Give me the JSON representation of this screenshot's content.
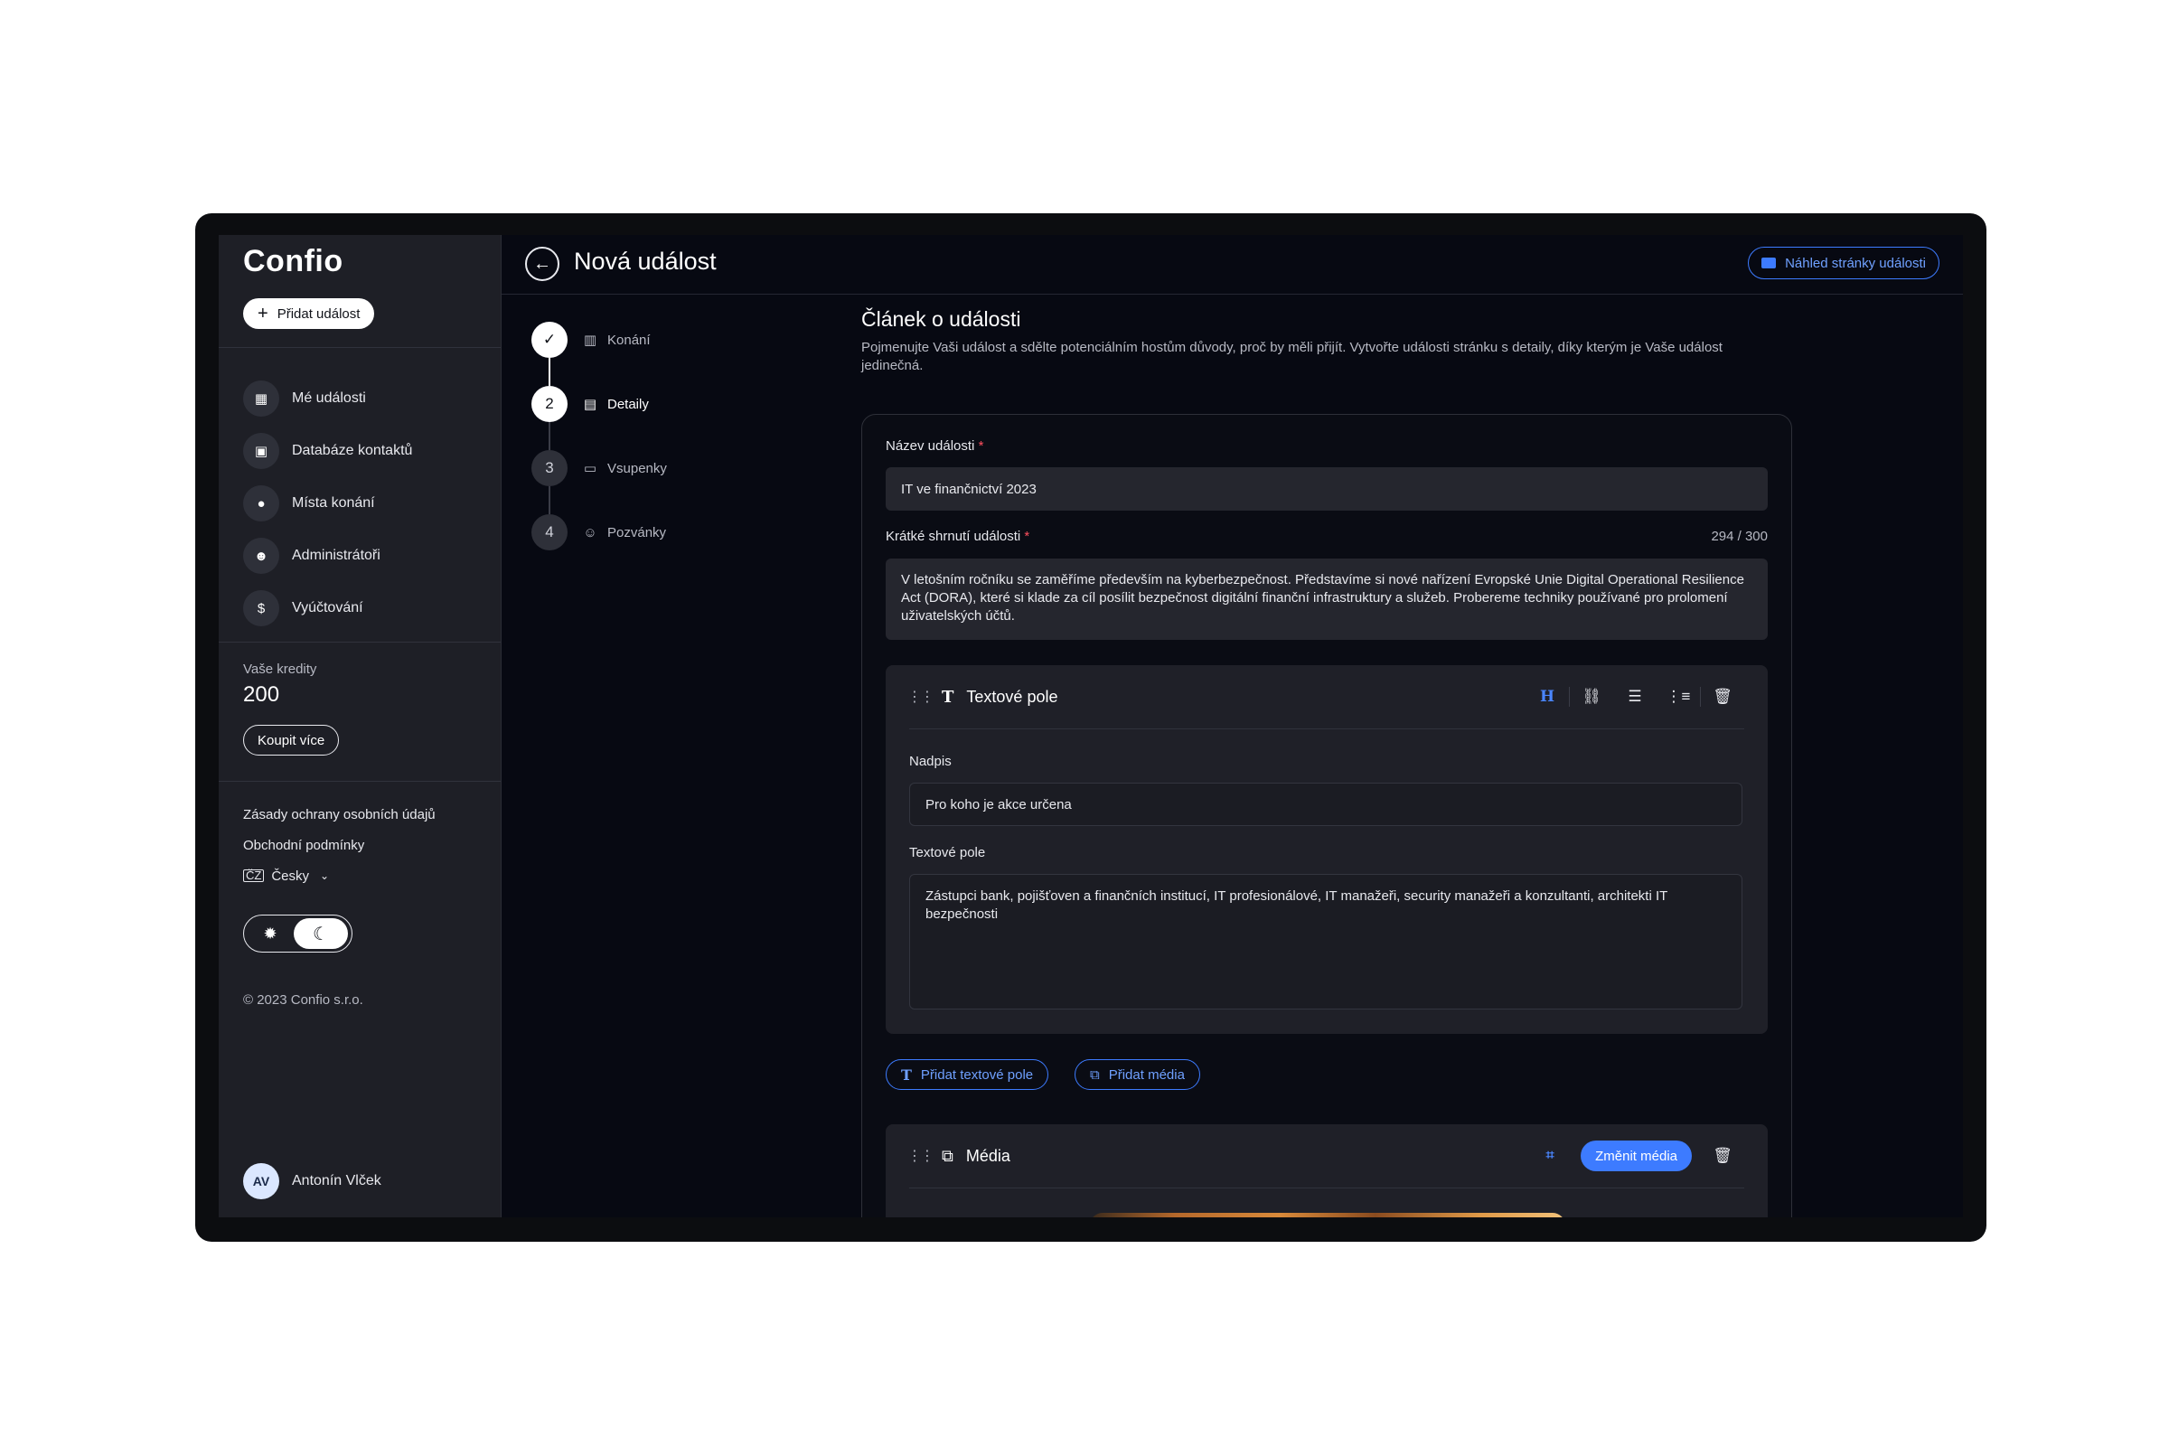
{
  "app": {
    "logo": "Confio",
    "add_event_label": "Přidat událost"
  },
  "sidebar": {
    "items": [
      {
        "label": "Mé události",
        "icon": "calendar-icon"
      },
      {
        "label": "Databáze kontaktů",
        "icon": "contact-book-icon"
      },
      {
        "label": "Místa konání",
        "icon": "map-pin-icon"
      },
      {
        "label": "Administrátoři",
        "icon": "user-key-icon"
      },
      {
        "label": "Vyúčtování",
        "icon": "dollar-icon"
      }
    ],
    "credits_label": "Vaše kredity",
    "credits_value": "200",
    "buy_more_label": "Koupit více",
    "privacy_label": "Zásady ochrany osobních údajů",
    "terms_label": "Obchodní podmínky",
    "language_label": "Česky",
    "copyright": "© 2023 Confio s.r.o.",
    "user_initials": "AV",
    "user_name": "Antonín Vlček"
  },
  "header": {
    "title": "Nová událost",
    "preview_label": "Náhled stránky události"
  },
  "steps": [
    {
      "number": "",
      "label": "Konání",
      "state": "done"
    },
    {
      "number": "2",
      "label": "Detaily",
      "state": "active"
    },
    {
      "number": "3",
      "label": "Vsupenky",
      "state": "pending"
    },
    {
      "number": "4",
      "label": "Pozvánky",
      "state": "pending"
    }
  ],
  "article": {
    "title": "Článek o události",
    "description": "Pojmenujte Vaši událost a sdělte potenciálním hostům důvody, proč by měli přijít. Vytvořte události stránku s detaily, díky kterým je Vaše událost jedinečná.",
    "name_label": "Název události",
    "name_value": "IT ve finančnictví 2023",
    "summary_label": "Krátké shrnutí události",
    "summary_counter": "294 / 300",
    "summary_value": "V letošním ročníku se zaměříme především na kyberbezpečnost. Představíme si nové nařízení Evropské Unie Digital Operational Resilience Act (DORA), které si klade za cíl posílit bezpečnost digitální finanční infrastruktury a služeb. Probereme techniky používané pro prolomení uživatelských účtů."
  },
  "text_block": {
    "type_label": "Textové pole",
    "heading_label": "Nadpis",
    "heading_value": "Pro koho je akce určena",
    "text_label": "Textové pole",
    "text_value": "Zástupci bank, pojišťoven a finančních institucí, IT profesionálové, IT manažeři, security manažeři a konzultanti, architekti IT bezpečnosti"
  },
  "add_buttons": {
    "add_text_label": "Přidat textové pole",
    "add_media_label": "Přidat média"
  },
  "media_block": {
    "type_label": "Média",
    "change_label": "Změnit média"
  },
  "colors": {
    "accent": "#3d7bff",
    "background": "#070912",
    "sidebar": "#1e1f26",
    "required": "#ff4f5e"
  }
}
